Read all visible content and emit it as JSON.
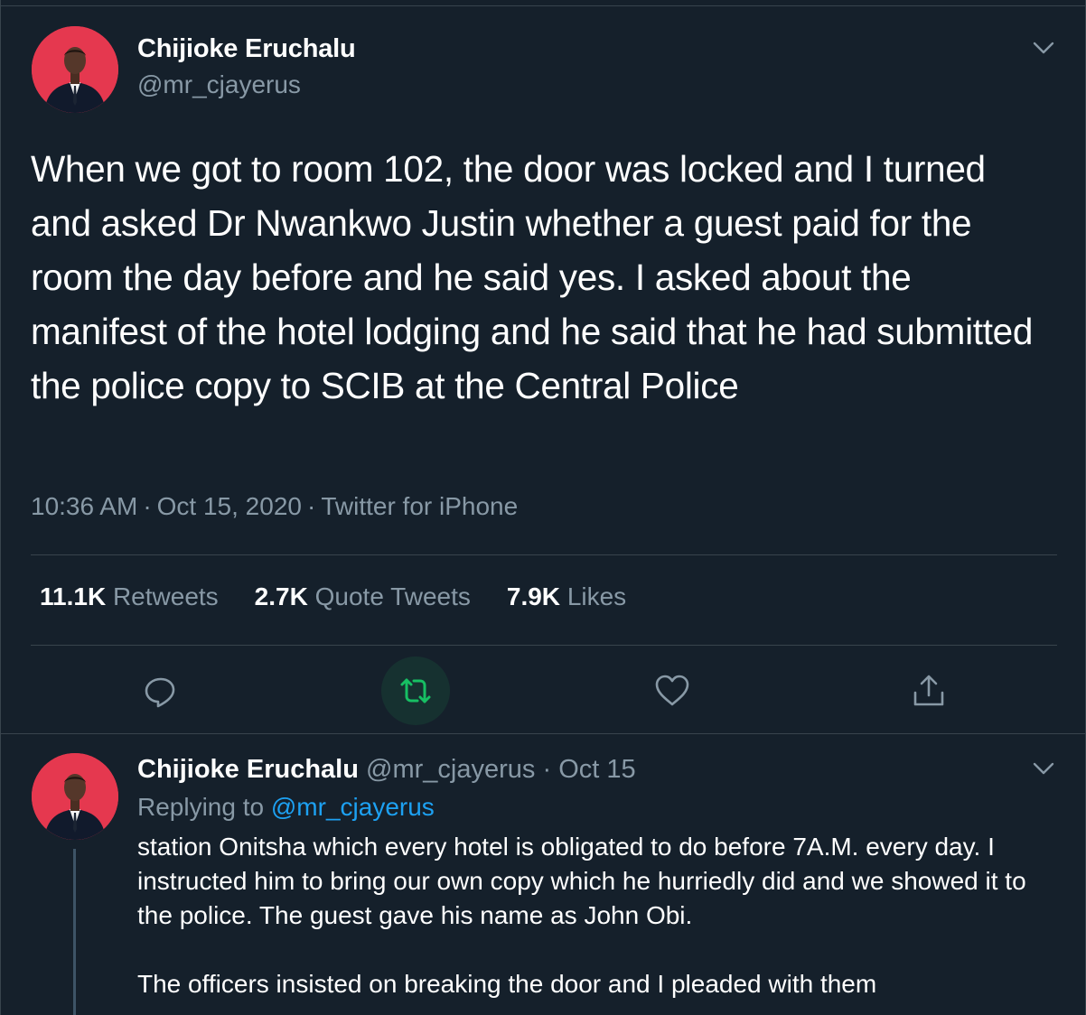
{
  "main_tweet": {
    "author_name": "Chijioke Eruchalu",
    "author_handle": "@mr_cjayerus",
    "text": "When we got to room 102, the door was locked and I turned and asked Dr Nwankwo Justin whether a guest paid for the room the day before and he said yes. I asked about the manifest of the hotel lodging and he said that he had submitted the police copy to SCIB at the Central Police",
    "time": "10:36 AM",
    "date": "Oct 15, 2020",
    "source": "Twitter for iPhone",
    "separator": "·",
    "stats": {
      "retweets_count": "11.1K",
      "retweets_label": "Retweets",
      "quotes_count": "2.7K",
      "quotes_label": "Quote Tweets",
      "likes_count": "7.9K",
      "likes_label": "Likes"
    },
    "actions": [
      "reply-icon",
      "retweet-icon",
      "like-icon",
      "share-icon"
    ]
  },
  "reply_tweet": {
    "author_name": "Chijioke Eruchalu",
    "author_handle": "@mr_cjayerus",
    "separator": "·",
    "date": "Oct 15",
    "replying_prefix": "Replying to",
    "replying_to": "@mr_cjayerus",
    "text": "station Onitsha which every hotel is obligated to do before 7A.M. every day. I instructed him to bring our own copy which he hurriedly did and we showed it to the police. The guest gave his name as John Obi.\n\nThe officers insisted on breaking the door and I pleaded with them"
  },
  "colors": {
    "background": "#15202b",
    "border": "#38444d",
    "secondary_text": "#8899a6",
    "link": "#1da1f2",
    "retweet_active": "#17bf63",
    "avatar_bg": "#e5384f"
  }
}
